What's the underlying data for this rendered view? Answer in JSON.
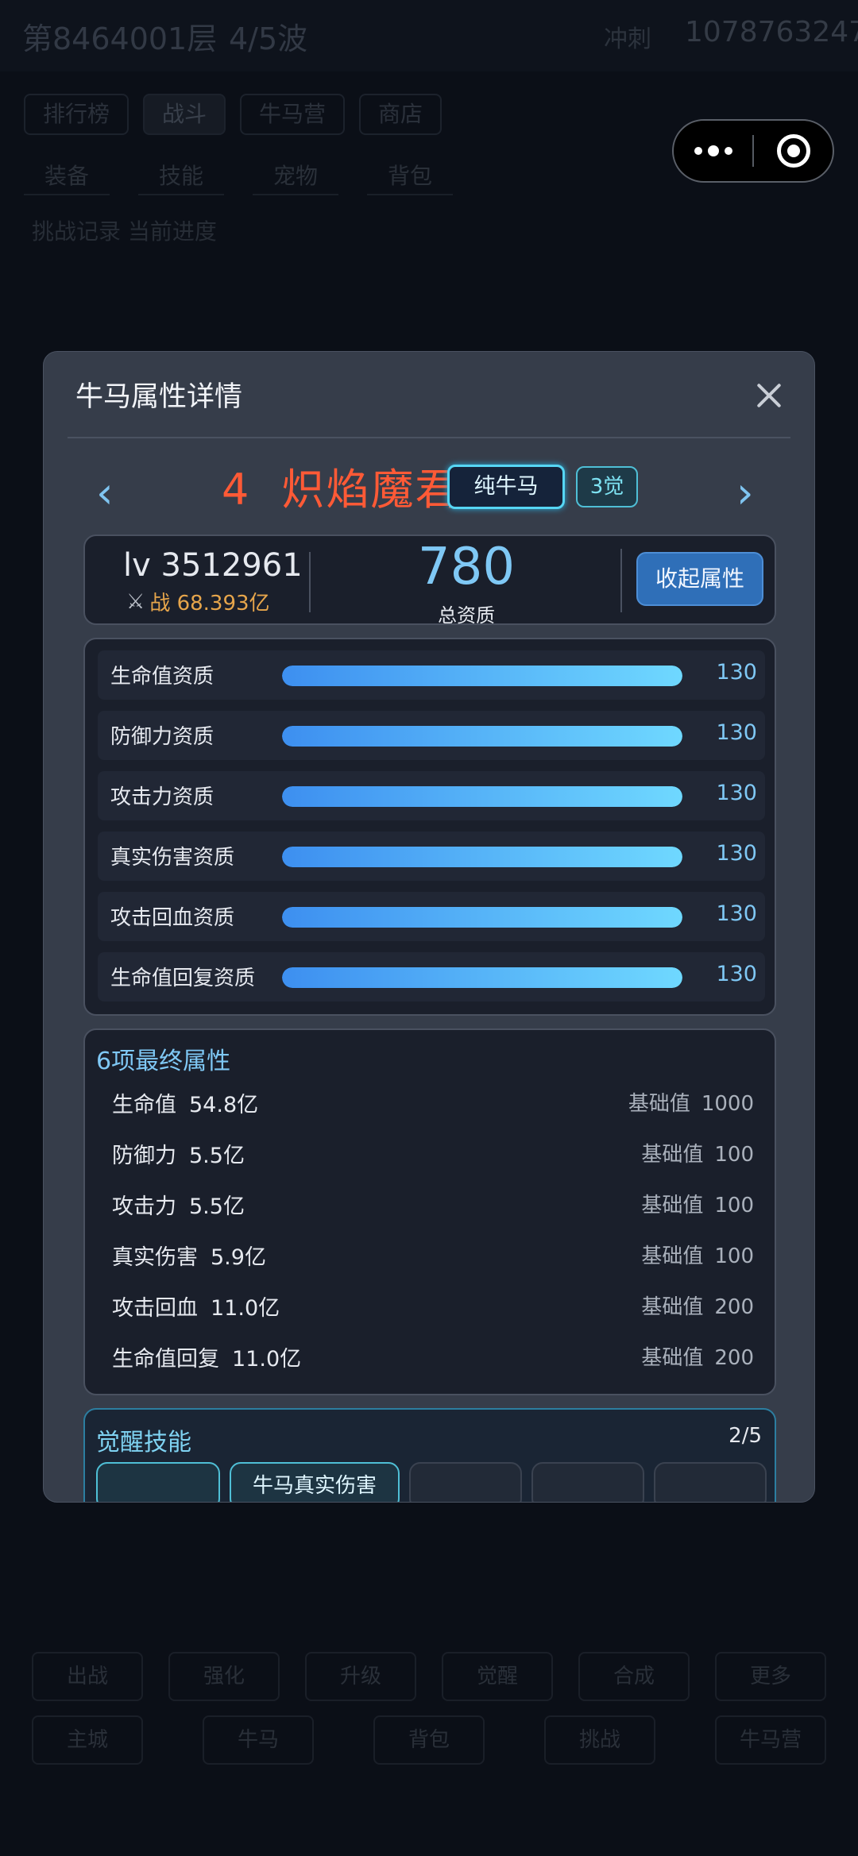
{
  "background": {
    "title": "第8464001层",
    "wave": "4/5波",
    "tag": "冲刺",
    "id": "1078763247",
    "tabs": [
      "排行榜",
      "战斗",
      "牛马营",
      "商店"
    ],
    "subtabs": [
      "装备",
      "技能",
      "宠物",
      "背包"
    ],
    "line": "挑战记录  当前进度",
    "bottom1": [
      "出战",
      "强化",
      "升级",
      "觉醒",
      "合成",
      "更多"
    ],
    "bottom2": [
      "主城",
      "牛马",
      "背包",
      "挑战",
      "牛马营"
    ]
  },
  "capsule": {
    "more_icon": "more-dots-icon",
    "close_icon": "target-ring-icon"
  },
  "modal": {
    "title": "牛马属性详情",
    "hero": {
      "index": "4",
      "name": "炽焰魔君",
      "type_badge": "纯牛马",
      "awake_badge": "3觉",
      "name_color": "#ff5a36"
    },
    "summary": {
      "level": "lv 3512961",
      "power": "战 68.393亿",
      "total_value": "780",
      "total_label": "总资质",
      "collapse_label": "收起属性"
    },
    "aptitudes": [
      {
        "label": "生命值资质",
        "value": "130",
        "fill": 1.0
      },
      {
        "label": "防御力资质",
        "value": "130",
        "fill": 1.0
      },
      {
        "label": "攻击力资质",
        "value": "130",
        "fill": 1.0
      },
      {
        "label": "真实伤害资质",
        "value": "130",
        "fill": 1.0
      },
      {
        "label": "攻击回血资质",
        "value": "130",
        "fill": 1.0
      },
      {
        "label": "生命值回复资质",
        "value": "130",
        "fill": 1.0
      }
    ],
    "final": {
      "title": "6项最终属性",
      "base_label": "基础值",
      "rows": [
        {
          "name": "生命值",
          "value": "54.8亿",
          "base": "1000"
        },
        {
          "name": "防御力",
          "value": "5.5亿",
          "base": "100"
        },
        {
          "name": "攻击力",
          "value": "5.5亿",
          "base": "100"
        },
        {
          "name": "真实伤害",
          "value": "5.9亿",
          "base": "100"
        },
        {
          "name": "攻击回血",
          "value": "11.0亿",
          "base": "200"
        },
        {
          "name": "生命值回复",
          "value": "11.0亿",
          "base": "200"
        }
      ]
    },
    "skills": {
      "title": "觉醒技能",
      "count": "2/5",
      "chips": [
        "",
        "牛马真实伤害",
        "",
        "",
        ""
      ]
    }
  },
  "colors": {
    "accent": "#7fc8f5",
    "hero_red": "#ff5a36",
    "power_gold": "#e6a54b",
    "bar_start": "#3d8ff0",
    "bar_end": "#6fd8ff"
  }
}
